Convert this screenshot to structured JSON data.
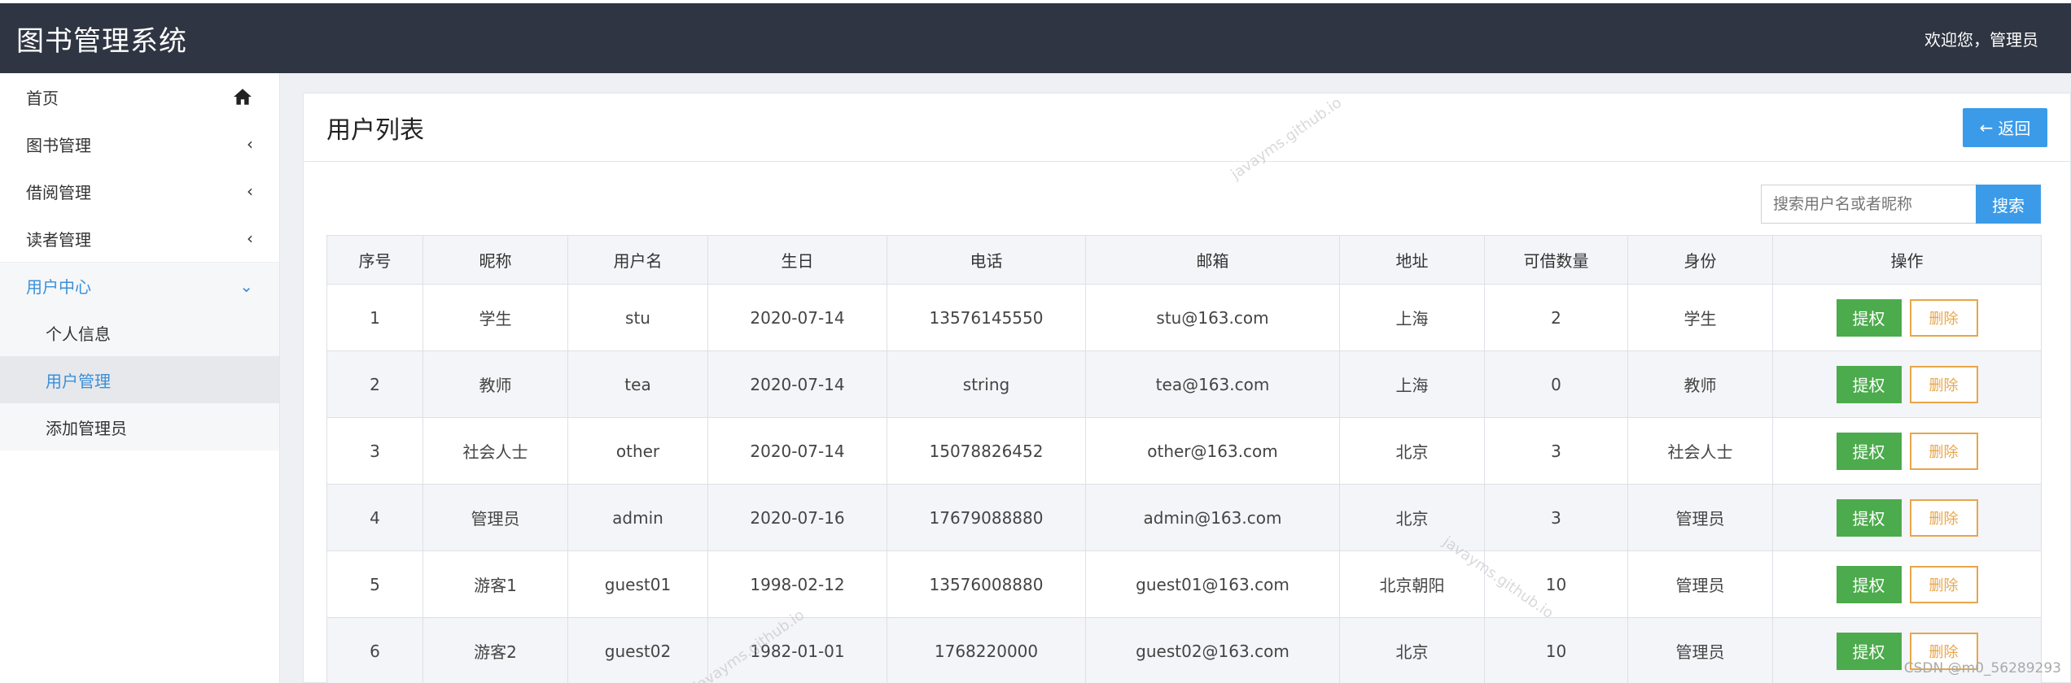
{
  "header": {
    "app_title": "图书管理系统",
    "welcome": "欢迎您，管理员"
  },
  "sidebar": {
    "items": [
      {
        "label": "首页",
        "icon": "home-icon"
      },
      {
        "label": "图书管理",
        "icon": "chevron-left-icon"
      },
      {
        "label": "借阅管理",
        "icon": "chevron-left-icon"
      },
      {
        "label": "读者管理",
        "icon": "chevron-left-icon"
      },
      {
        "label": "用户中心",
        "icon": "chevron-down-icon"
      }
    ],
    "sub_items": [
      {
        "label": "个人信息"
      },
      {
        "label": "用户管理"
      },
      {
        "label": "添加管理员"
      }
    ]
  },
  "main": {
    "title": "用户列表",
    "back_label": "返回",
    "search_placeholder": "搜索用户名或者昵称",
    "search_label": "搜索",
    "columns": [
      "序号",
      "昵称",
      "用户名",
      "生日",
      "电话",
      "邮箱",
      "地址",
      "可借数量",
      "身份",
      "操作"
    ],
    "rows": [
      {
        "no": "1",
        "nickname": "学生",
        "username": "stu",
        "birthday": "2020-07-14",
        "phone": "13576145550",
        "email": "stu@163.com",
        "address": "上海",
        "quota": "2",
        "role": "学生"
      },
      {
        "no": "2",
        "nickname": "教师",
        "username": "tea",
        "birthday": "2020-07-14",
        "phone": "string",
        "email": "tea@163.com",
        "address": "上海",
        "quota": "0",
        "role": "教师"
      },
      {
        "no": "3",
        "nickname": "社会人士",
        "username": "other",
        "birthday": "2020-07-14",
        "phone": "15078826452",
        "email": "other@163.com",
        "address": "北京",
        "quota": "3",
        "role": "社会人士"
      },
      {
        "no": "4",
        "nickname": "管理员",
        "username": "admin",
        "birthday": "2020-07-16",
        "phone": "17679088880",
        "email": "admin@163.com",
        "address": "北京",
        "quota": "3",
        "role": "管理员"
      },
      {
        "no": "5",
        "nickname": "游客1",
        "username": "guest01",
        "birthday": "1998-02-12",
        "phone": "13576008880",
        "email": "guest01@163.com",
        "address": "北京朝阳",
        "quota": "10",
        "role": "管理员"
      },
      {
        "no": "6",
        "nickname": "游客2",
        "username": "guest02",
        "birthday": "1982-01-01",
        "phone": "1768220000",
        "email": "guest02@163.com",
        "address": "北京",
        "quota": "10",
        "role": "管理员"
      }
    ],
    "auth_label": "提权",
    "delete_label": "删除"
  },
  "watermarks": {
    "text": "javayms.github.io",
    "csdn": "CSDN @m0_56289293"
  },
  "colors": {
    "header_bg": "#2f3542",
    "accent": "#3c9be8",
    "auth_green": "#4cab4c",
    "delete_orange": "#e8a64a"
  }
}
